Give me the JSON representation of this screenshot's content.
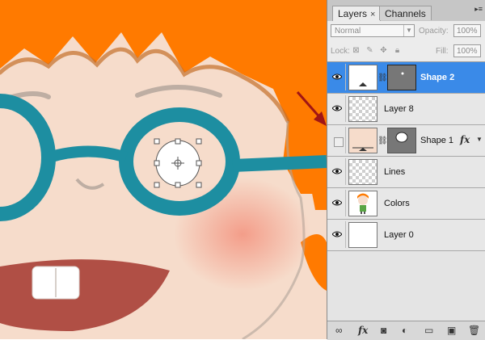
{
  "panel": {
    "tabs": [
      {
        "label": "Layers",
        "close": "×",
        "active": true
      },
      {
        "label": "Channels",
        "active": false
      }
    ],
    "menu_icon": "panel-menu-icon",
    "blend_mode": "Normal",
    "opacity_label": "Opacity:",
    "opacity_value": "100%",
    "lock_label": "Lock:",
    "fill_label": "Fill:",
    "fill_value": "100%",
    "layers": [
      {
        "name": "Shape 2",
        "visible": true,
        "selected": true,
        "thumb": "white-box",
        "has_mask": true
      },
      {
        "name": "Layer 8",
        "visible": true,
        "selected": false,
        "thumb": "transparent",
        "has_mask": false
      },
      {
        "name": "Shape 1",
        "visible": false,
        "selected": false,
        "thumb": "peach-box",
        "has_mask": true,
        "fx": "fx"
      },
      {
        "name": "Lines",
        "visible": true,
        "selected": false,
        "thumb": "transparent",
        "has_mask": false
      },
      {
        "name": "Colors",
        "visible": true,
        "selected": false,
        "thumb": "character",
        "has_mask": false
      },
      {
        "name": "Layer 0",
        "visible": true,
        "selected": false,
        "thumb": "white",
        "has_mask": false
      }
    ],
    "bottom_icons": [
      "link-layers-icon",
      "fx-icon",
      "mask-icon",
      "adjustment-icon",
      "folder-icon",
      "new-layer-icon",
      "trash-icon"
    ],
    "bottom_fx": "fx"
  },
  "colors": {
    "selection_blue": "#3a8ae8",
    "skin": "#f6dccb",
    "hair": "#ff7a00",
    "glasses": "#1d8ea1",
    "arrow": "#a01515"
  }
}
